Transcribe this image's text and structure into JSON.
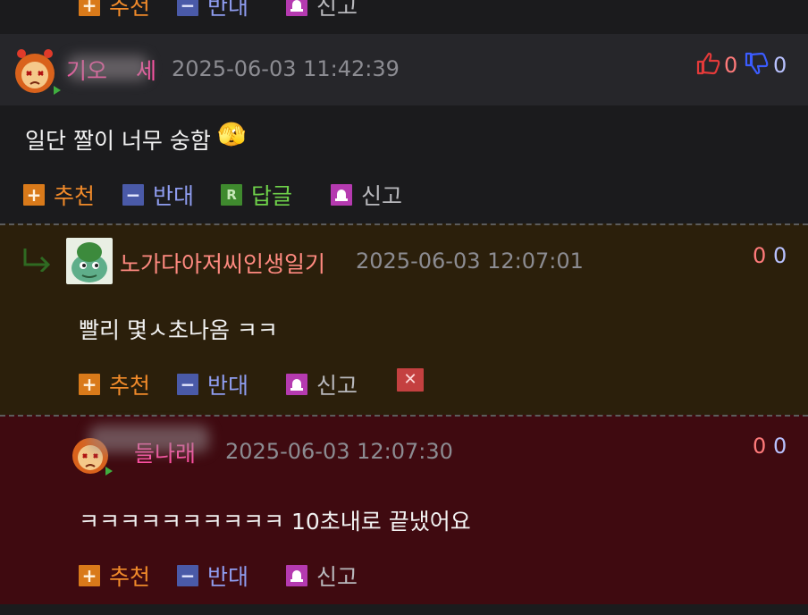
{
  "actions": {
    "recommend": "추천",
    "oppose": "반대",
    "reply": "답글",
    "report": "신고",
    "reply_icon_letter": "R"
  },
  "comments": [
    {
      "nickname": "기오",
      "nickname_suffix": "세",
      "datetime": "2025-06-03 11:42:39",
      "body": "일단 짤이 너무 숭함",
      "emoji": "🫣",
      "likes": "0",
      "dislikes": "0"
    },
    {
      "nickname": "노가다아저씨인생일기",
      "datetime": "2025-06-03 12:07:01",
      "body": "빨리 몇ㅅ초나옴 ㅋㅋ",
      "likes": "0",
      "dislikes": "0"
    },
    {
      "nickname": "들나래",
      "datetime": "2025-06-03 12:07:30",
      "body": "ㅋㅋㅋㅋㅋㅋㅋㅋㅋㅋ 10초내로 끝냈어요",
      "likes": "0",
      "dislikes": "0"
    }
  ],
  "colors": {
    "page_bg": "#1b1b1d",
    "reply_bg": "#2b1f0b",
    "author_bg": "#3f0a10",
    "nick_pink": "#ff4fa3",
    "nick_salmon": "#ff8a80",
    "like_red": "#ff7a7a",
    "dislike_blue": "#b9c2ff"
  }
}
